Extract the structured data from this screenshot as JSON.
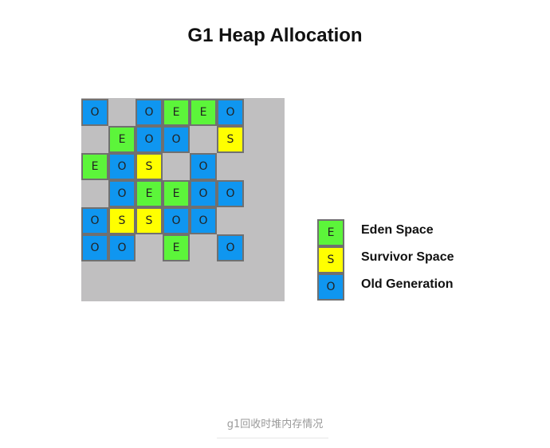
{
  "title": "G1 Heap Allocation",
  "grid": {
    "rows": [
      [
        "O",
        "",
        "O",
        "E",
        "E",
        "O"
      ],
      [
        "",
        "E",
        "O",
        "O",
        "",
        "S"
      ],
      [
        "E",
        "O",
        "S",
        "",
        "O",
        ""
      ],
      [
        "",
        "O",
        "E",
        "E",
        "O",
        "O"
      ],
      [
        "O",
        "S",
        "S",
        "O",
        "O",
        ""
      ],
      [
        "O",
        "O",
        "",
        "E",
        "",
        "O"
      ]
    ]
  },
  "colors": {
    "E": "#5cf53a",
    "S": "#ffff00",
    "O": "#0f96f0",
    "heap_background": "#c0bfc0"
  },
  "legend": [
    {
      "letter": "E",
      "label": "Eden Space"
    },
    {
      "letter": "S",
      "label": "Survivor Space"
    },
    {
      "letter": "O",
      "label": "Old Generation"
    }
  ],
  "caption": "g1回收时堆内存情况"
}
